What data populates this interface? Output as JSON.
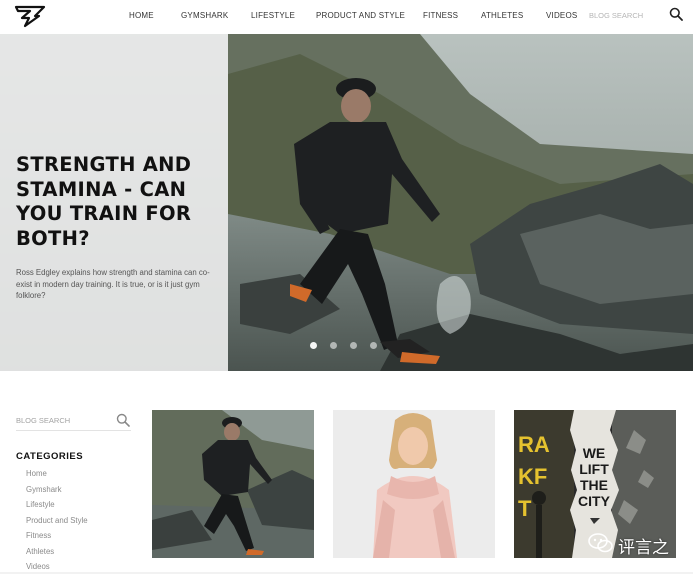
{
  "header": {
    "logo_icon": "shark-logo-icon",
    "nav": [
      {
        "label": "HOME"
      },
      {
        "label": "GYMSHARK"
      },
      {
        "label": "LIFESTYLE"
      },
      {
        "label": "PRODUCT AND STYLE"
      },
      {
        "label": "FITNESS"
      },
      {
        "label": "ATHLETES"
      },
      {
        "label": "VIDEOS"
      }
    ],
    "search_placeholder": "BLOG SEARCH",
    "search_icon": "search-icon"
  },
  "hero": {
    "title": "STRENGTH AND STAMINA - CAN YOU TRAIN FOR BOTH?",
    "description": "Ross Edgley explains how strength and stamina can co-exist in modern day training. It is true, or is it just gym folklore?",
    "slide_count": 4,
    "active_slide": 1
  },
  "sidebar": {
    "search_placeholder": "BLOG SEARCH",
    "categories_title": "CATEGORIES",
    "categories": [
      {
        "label": "Home"
      },
      {
        "label": "Gymshark"
      },
      {
        "label": "Lifestyle"
      },
      {
        "label": "Product and Style"
      },
      {
        "label": "Fitness"
      },
      {
        "label": "Athletes"
      },
      {
        "label": "Videos"
      }
    ]
  },
  "cards": [
    {
      "image": "runner-in-stream"
    },
    {
      "image": "woman-in-pink-hoodie"
    },
    {
      "image": "we-lift-the-city-poster",
      "poster_text": [
        "WE",
        "LIFT",
        "THE",
        "CITY"
      ],
      "side_letters": [
        "RA",
        "KF",
        "T"
      ]
    }
  ],
  "watermark": {
    "text": "评言之",
    "icon": "wechat-icon"
  },
  "colors": {
    "accent": "#111111",
    "panel": "#ececec",
    "muted_text": "#8a8a8a",
    "hoodie": "#f1c9c1"
  }
}
